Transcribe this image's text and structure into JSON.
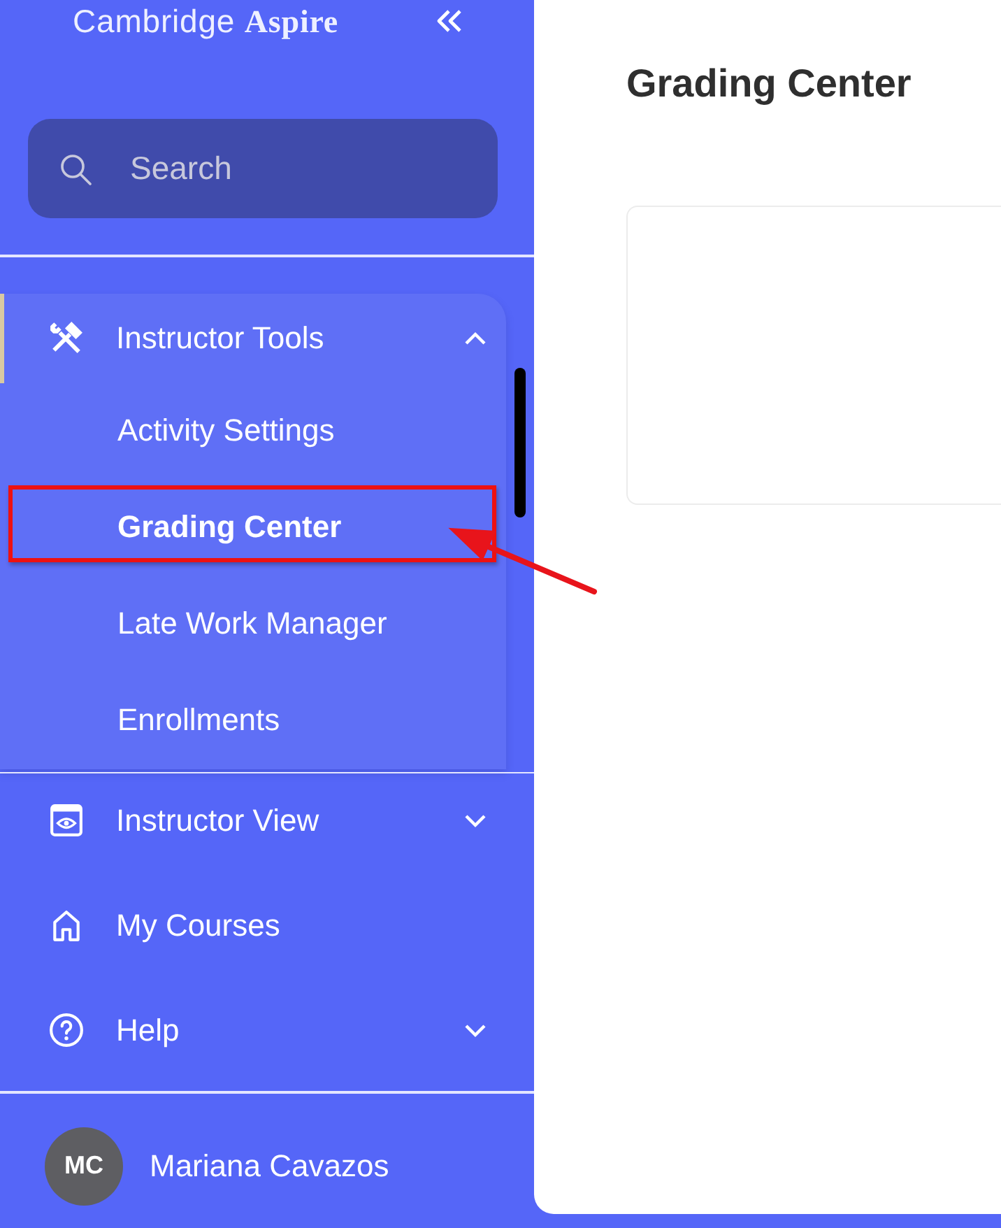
{
  "sidebar": {
    "logo": "Cambridge **Aspire**",
    "search": {
      "placeholder": "Search"
    },
    "sections": [
      {
        "items": [
          {
            "kind": "menu",
            "label": "Instructor Tools",
            "active": true,
            "expanded": true,
            "children": [
              {
                "label": "Activity Settings",
                "selected": false
              },
              {
                "label": "Grading Center",
                "selected": true
              },
              {
                "label": "Late Work Manager",
                "selected": false
              },
              {
                "label": "Enrollments",
                "selected": false
              }
            ]
          }
        ]
      },
      {
        "items": [
          {
            "kind": "menu",
            "label": "Instructor View",
            "active": false,
            "expanded": false
          },
          {
            "kind": "link",
            "label": "My Courses",
            "active": false
          },
          {
            "kind": "menu",
            "label": "Help",
            "active": false,
            "expanded": false
          }
        ]
      }
    ],
    "user": {
      "initials": "MC",
      "name": "Mariana Cavazos"
    }
  },
  "main": {
    "title": "Grading Center"
  }
}
